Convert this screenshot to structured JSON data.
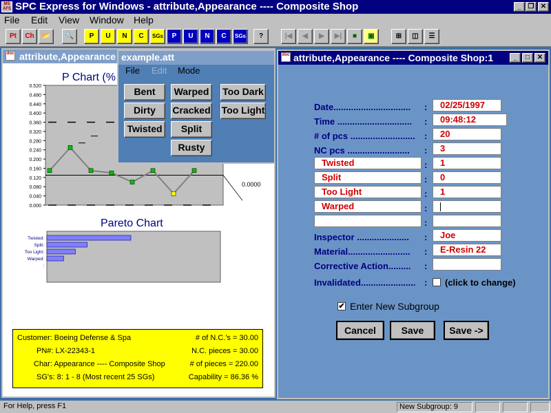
{
  "app": {
    "title": "SPC Express for Windows - attribute,Appearance ---- Composite Shop",
    "icon_text": "MS AFS"
  },
  "menu": [
    "File",
    "Edit",
    "View",
    "Window",
    "Help"
  ],
  "toolbar": {
    "buttons": [
      "Pt",
      "Ch",
      "open-folder-icon",
      "preview-icon",
      "P",
      "U",
      "N",
      "C",
      "SGs",
      "P",
      "U",
      "N",
      "C",
      "SGs",
      "help-icon",
      "first-icon",
      "prev-icon",
      "next-icon",
      "last-icon",
      "save-icon",
      "export-icon",
      "tile-icon",
      "cascade-icon",
      "horizontal-icon"
    ]
  },
  "chart_window": {
    "title": "attribute,Appearance",
    "p_chart_title": "P Chart (%",
    "pareto_title": "Pareto Chart",
    "right_value": "0.0000"
  },
  "chart_data": [
    {
      "type": "line",
      "title": "P Chart (%",
      "y_ticks": [
        "0.520",
        "0.480",
        "0.440",
        "0.400",
        "0.360",
        "0.320",
        "0.280",
        "0.240",
        "0.200",
        "0.160",
        "0.120",
        "0.080",
        "0.040",
        "0.000"
      ],
      "ylim": [
        0,
        0.52
      ],
      "x": [
        1,
        2,
        3,
        4,
        5,
        6,
        7,
        8
      ],
      "values": [
        0.15,
        0.25,
        0.15,
        0.14,
        0.1,
        0.15,
        0.05,
        0.15
      ],
      "center_line": 0.13
    },
    {
      "type": "bar",
      "title": "Pareto Chart",
      "categories": [
        "Twisted:",
        "Split:",
        "Too Light:",
        "Warped:",
        ":"
      ],
      "values": [
        100,
        48,
        34,
        20,
        0
      ]
    }
  ],
  "info_box": {
    "customer": "Customer: Boeing Defense & Spa",
    "nc_count": "# of N.C.'s = 30.00",
    "pn": "PN#: LX-22343-1",
    "nc_pieces": "N.C. pieces = 30.00",
    "char": "Char: Appearance ---- Composite Shop",
    "pieces": "# of pieces = 220.00",
    "sgs": "SG's: 8: 1 - 8 (Most recent 25 SGs)",
    "capability": "Capability = 86.36 %"
  },
  "popup": {
    "title": "example.att",
    "menu": [
      "File",
      "Edit",
      "Mode"
    ],
    "buttons": [
      "Bent",
      "Warped",
      "Too Dark",
      "Dirty",
      "Cracked",
      "Too Light",
      "Twisted",
      "Split",
      "Rusty"
    ]
  },
  "form_window": {
    "title": "attribute,Appearance ---- Composite Shop:1",
    "date_label": "Date...............................",
    "date_value": "02/25/1997",
    "time_label": "Time ..............................",
    "time_value": "09:48:12",
    "pcs_label": "# of pcs ..........................",
    "pcs_value": "20",
    "nc_label": "NC pcs .........................",
    "nc_value": "3",
    "nc_rows": [
      {
        "label": "Twisted",
        "value": "1"
      },
      {
        "label": "Split",
        "value": "0"
      },
      {
        "label": "Too Light",
        "value": "1"
      },
      {
        "label": "Warped",
        "value": ""
      },
      {
        "label": "",
        "value": ""
      }
    ],
    "inspector_label": "Inspector .....................",
    "inspector_value": "Joe",
    "material_label": "Material.........................",
    "material_value": "E-Resin 22",
    "corrective_label": "Corrective Action.........",
    "corrective_value": "",
    "invalidated_label": "Invalidated......................",
    "invalidated_hint": "(click to change)",
    "enter_new_label": "Enter New Subgroup",
    "cancel": "Cancel",
    "save": "Save",
    "save_next": "Save ->"
  },
  "status": {
    "help": "For Help, press F1",
    "subgroup": "New Subgroup: 9"
  }
}
